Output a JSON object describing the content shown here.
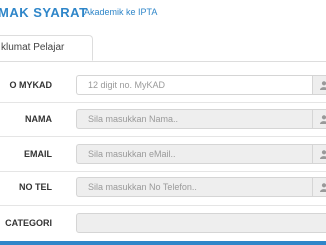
{
  "header": {
    "title": "MAK SYARAT",
    "subtitle": "Akademik ke IPTA"
  },
  "tabs": [
    {
      "label": "klumat Pelajar",
      "active": true
    }
  ],
  "form": {
    "mykad": {
      "label": "O MYKAD",
      "placeholder": "12 digit no. MyKAD",
      "icon": "user-icon"
    },
    "nama": {
      "label": "NAMA",
      "placeholder": "Sila masukkan Nama..",
      "icon": "user-icon"
    },
    "email": {
      "label": "EMAIL",
      "placeholder": "Sila masukkan eMail..",
      "icon": "user-icon"
    },
    "notel": {
      "label": "NO TEL",
      "placeholder": "Sila masukkan No Telefon..",
      "icon": "user-icon"
    },
    "kategori": {
      "label": "CATEGORI",
      "value": ""
    }
  },
  "colors": {
    "accent": "#2f86c9",
    "field_disabled": "#eeeeee",
    "border": "#d5d5d5"
  }
}
